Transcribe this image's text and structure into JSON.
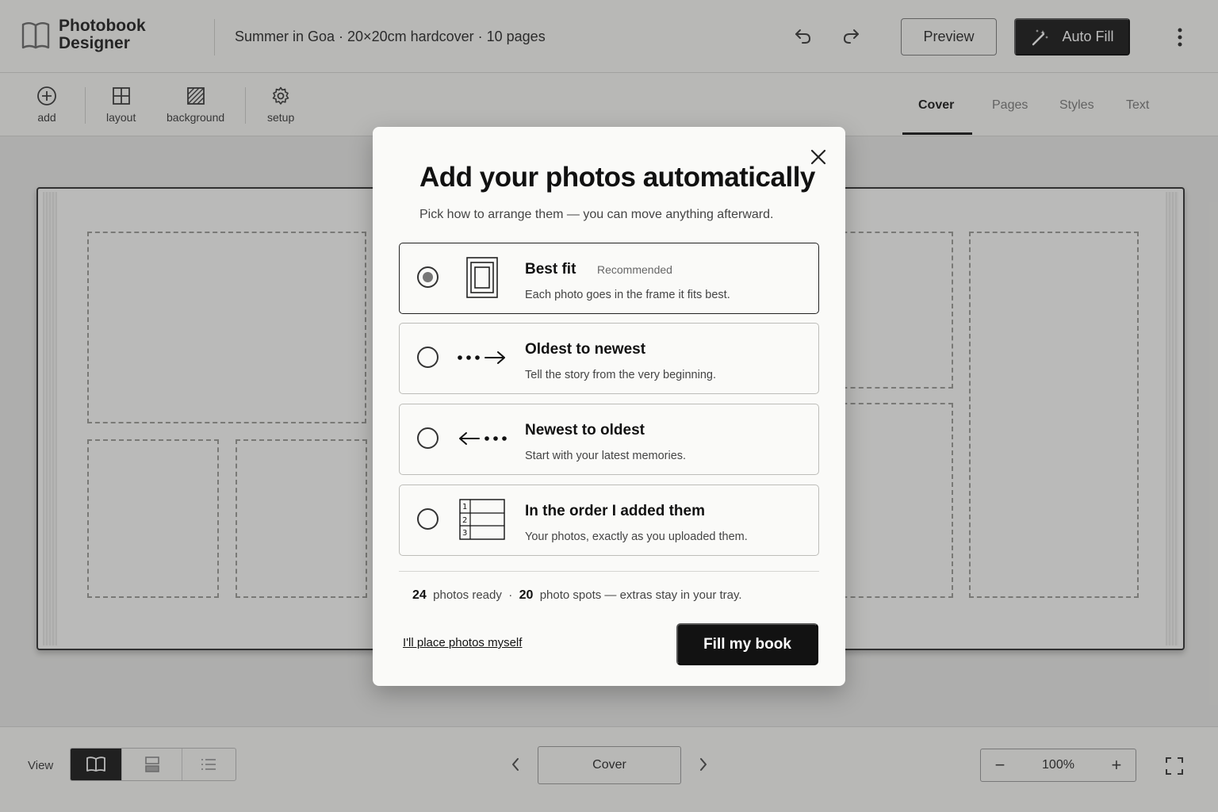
{
  "app": {
    "brand_line1": "Photobook",
    "brand_line2": "Designer",
    "doc_title": "Summer in Goa · 20×20cm hardcover · 10 pages",
    "preview_label": "Preview",
    "autofill_label": "Auto Fill"
  },
  "toolbar": {
    "tools": [
      {
        "label": "add",
        "icon": "plus-circle-icon"
      },
      {
        "label": "layout",
        "icon": "grid-icon"
      },
      {
        "label": "background",
        "icon": "hatch-icon"
      },
      {
        "label": "setup",
        "icon": "gear-icon"
      }
    ],
    "tabs": [
      {
        "label": "Cover",
        "active": true
      },
      {
        "label": "Pages",
        "active": false
      },
      {
        "label": "Styles",
        "active": false
      },
      {
        "label": "Text",
        "active": false
      }
    ]
  },
  "bottom": {
    "view_label": "View",
    "view_modes": [
      "book-icon",
      "pages-icon",
      "list-icon"
    ],
    "current_page": "Cover",
    "zoom": "100%"
  },
  "modal": {
    "title": "Add your photos automatically",
    "subtitle": "Pick how to arrange them — you can move anything afterward.",
    "options": [
      {
        "title": "Best fit",
        "badge": "Recommended",
        "desc": "Each photo goes in the frame it fits best.",
        "selected": true,
        "icon": "frame-icon"
      },
      {
        "title": "Oldest to newest",
        "desc": "Tell the story from the very beginning.",
        "selected": false,
        "icon": "dots-arrow-right-icon"
      },
      {
        "title": "Newest to oldest",
        "desc": "Start with your latest memories.",
        "selected": false,
        "icon": "arrow-left-dots-icon"
      },
      {
        "title": "In the order I added them",
        "desc": "Your photos, exactly as you uploaded them.",
        "selected": false,
        "icon": "numbered-list-icon"
      }
    ],
    "summary": {
      "photos_count": "24",
      "photos_text": "photos ready",
      "sep": "·",
      "spots_count": "20",
      "spots_text": "photo spots — extras stay in your tray."
    },
    "manual_link": "I'll place photos myself",
    "fill_button": "Fill my book"
  }
}
